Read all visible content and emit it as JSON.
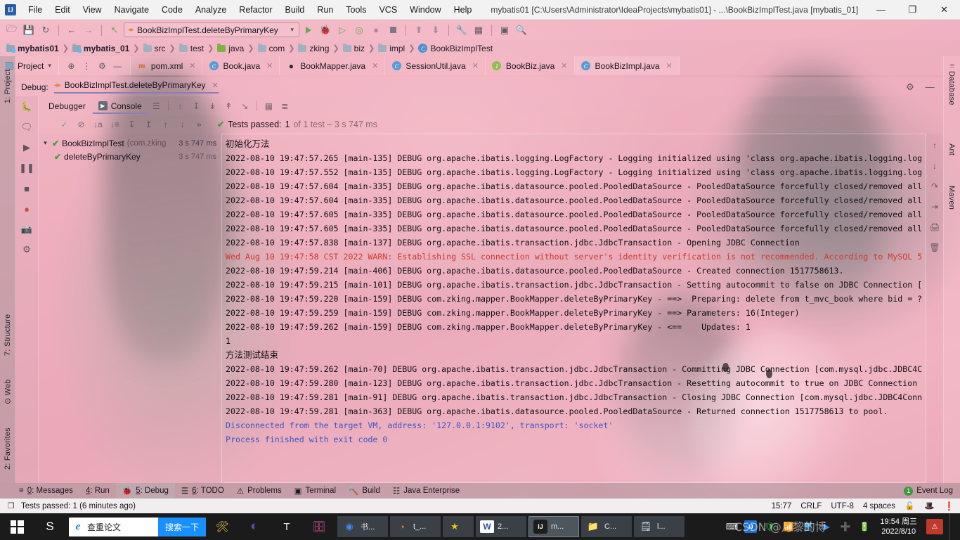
{
  "titlebar": {
    "logo": "IJ",
    "title": "mybatis01 [C:\\Users\\Administrator\\IdeaProjects\\mybatis01] - ...\\BookBizImplTest.java [mybatis_01]",
    "menu": [
      "File",
      "Edit",
      "View",
      "Navigate",
      "Code",
      "Analyze",
      "Refactor",
      "Build",
      "Run",
      "Tools",
      "VCS",
      "Window",
      "Help"
    ],
    "minimize": "—",
    "maximize": "❐",
    "close": "✕"
  },
  "toolbar": {
    "open_icon": "🗁",
    "save_icon": "💾",
    "sync_icon": "↻",
    "back_icon": "←",
    "forward_icon": "→",
    "build_icon": "↖",
    "run_config": "BookBizImplTest.deleteByPrimaryKey",
    "run_icon": "▶",
    "debug_icon": "🐞",
    "coverage_icon": "▶",
    "profile_icon": "▶",
    "attach_icon": "▶",
    "stop_icon": "■",
    "deploy_icon": "⬆",
    "update_icon": "⬇",
    "settings_icon": "🔧",
    "structure_icon": "⬛",
    "layout_icon": "◱",
    "search_icon": "🔍"
  },
  "breadcrumb": [
    {
      "label": "mybatis01",
      "type": "module",
      "bold": true
    },
    {
      "label": "mybatis_01",
      "type": "module",
      "bold": true
    },
    {
      "label": "src",
      "type": "folder",
      "bold": false
    },
    {
      "label": "test",
      "type": "folder",
      "bold": false
    },
    {
      "label": "java",
      "type": "source-folder",
      "bold": false
    },
    {
      "label": "com",
      "type": "folder",
      "bold": false
    },
    {
      "label": "zking",
      "type": "folder",
      "bold": false
    },
    {
      "label": "biz",
      "type": "folder",
      "bold": false
    },
    {
      "label": "impl",
      "type": "folder",
      "bold": false
    },
    {
      "label": "BookBizImplTest",
      "type": "class",
      "bold": false
    }
  ],
  "project_panel": {
    "label": "Project",
    "caret": "▾",
    "locate_icon": "⊕",
    "collapse_icon": "➕",
    "settings_icon": "⚙",
    "hide_icon": "—"
  },
  "editor_tabs": [
    {
      "label": "pom.xml",
      "icon": "m",
      "type": "maven",
      "active": false
    },
    {
      "label": "Book.java",
      "icon": "C",
      "type": "class",
      "active": false
    },
    {
      "label": "BookMapper.java",
      "icon": "◕",
      "type": "mapper",
      "active": false
    },
    {
      "label": "SessionUtil.java",
      "icon": "C",
      "type": "class",
      "active": false
    },
    {
      "label": "BookBiz.java",
      "icon": "I",
      "type": "interface",
      "active": false
    },
    {
      "label": "BookBizImpl.java",
      "icon": "C",
      "type": "class",
      "active": true
    }
  ],
  "left_tool_tabs": [
    "1: Project",
    "7: Structure",
    "⊙ Web",
    "2: Favorites"
  ],
  "right_tool_tabs": [
    "Database",
    "Ant",
    "Maven"
  ],
  "debug_window": {
    "label": "Debug:",
    "config_name": "BookBizImplTest.deleteByPrimaryKey",
    "close": "✕",
    "settings_icon": "⚙",
    "hide_icon": "—",
    "tabs": [
      {
        "label": "Debugger",
        "active": false
      },
      {
        "label": "Console",
        "active": true
      }
    ],
    "rail_icons": [
      "🐞",
      "💬",
      "⏸",
      "⏹",
      "🔴",
      "📷",
      "⚙"
    ],
    "toolbar_icons": [
      "✓",
      "⊘",
      "↓az",
      "↓≡",
      "↧",
      "↥",
      "↑",
      "↓",
      "»"
    ]
  },
  "test_status": {
    "check": "✔",
    "label": "Tests passed:",
    "count": "1",
    "detail": "of 1 test – 3 s 747 ms"
  },
  "test_tree": [
    {
      "name": "BookBizImplTest",
      "package": "(com.zking",
      "time": "3 s 747 ms",
      "level": 0,
      "expanded": true,
      "status": "passed"
    },
    {
      "name": "deleteByPrimaryKey",
      "package": "",
      "time": "3 s 747 ms",
      "level": 1,
      "expanded": false,
      "status": "passed"
    }
  ],
  "console_lines": [
    {
      "text": "初始化万法",
      "style": "cn"
    },
    {
      "text": "2022-08-10 19:47:57.265 [main-135] DEBUG org.apache.ibatis.logging.LogFactory - Logging initialized using 'class org.apache.ibatis.logging.log",
      "style": "normal"
    },
    {
      "text": "2022-08-10 19:47:57.552 [main-135] DEBUG org.apache.ibatis.logging.LogFactory - Logging initialized using 'class org.apache.ibatis.logging.log",
      "style": "normal"
    },
    {
      "text": "2022-08-10 19:47:57.604 [main-335] DEBUG org.apache.ibatis.datasource.pooled.PooledDataSource - PooledDataSource forcefully closed/removed all",
      "style": "normal"
    },
    {
      "text": "2022-08-10 19:47:57.604 [main-335] DEBUG org.apache.ibatis.datasource.pooled.PooledDataSource - PooledDataSource forcefully closed/removed all",
      "style": "normal"
    },
    {
      "text": "2022-08-10 19:47:57.605 [main-335] DEBUG org.apache.ibatis.datasource.pooled.PooledDataSource - PooledDataSource forcefully closed/removed all",
      "style": "normal"
    },
    {
      "text": "2022-08-10 19:47:57.605 [main-335] DEBUG org.apache.ibatis.datasource.pooled.PooledDataSource - PooledDataSource forcefully closed/removed all",
      "style": "normal"
    },
    {
      "text": "2022-08-10 19:47:57.838 [main-137] DEBUG org.apache.ibatis.transaction.jdbc.JdbcTransaction - Opening JDBC Connection",
      "style": "normal"
    },
    {
      "text": "Wed Aug 10 19:47:58 CST 2022 WARN: Establishing SSL connection without server's identity verification is not recommended. According to MySQL 5",
      "style": "warn"
    },
    {
      "text": "2022-08-10 19:47:59.214 [main-406] DEBUG org.apache.ibatis.datasource.pooled.PooledDataSource - Created connection 1517758613.",
      "style": "normal"
    },
    {
      "text": "2022-08-10 19:47:59.215 [main-101] DEBUG org.apache.ibatis.transaction.jdbc.JdbcTransaction - Setting autocommit to false on JDBC Connection [",
      "style": "normal"
    },
    {
      "text": "2022-08-10 19:47:59.220 [main-159] DEBUG com.zking.mapper.BookMapper.deleteByPrimaryKey - ==>  Preparing: delete from t_mvc_book where bid = ?",
      "style": "normal"
    },
    {
      "text": "2022-08-10 19:47:59.259 [main-159] DEBUG com.zking.mapper.BookMapper.deleteByPrimaryKey - ==> Parameters: 16(Integer)",
      "style": "normal"
    },
    {
      "text": "2022-08-10 19:47:59.262 [main-159] DEBUG com.zking.mapper.BookMapper.deleteByPrimaryKey - <==    Updates: 1",
      "style": "normal"
    },
    {
      "text": "1",
      "style": "normal"
    },
    {
      "text": "方法测试结束",
      "style": "cn"
    },
    {
      "text": "2022-08-10 19:47:59.262 [main-70] DEBUG org.apache.ibatis.transaction.jdbc.JdbcTransaction - Committing JDBC Connection [com.mysql.jdbc.JDBC4C",
      "style": "normal"
    },
    {
      "text": "2022-08-10 19:47:59.280 [main-123] DEBUG org.apache.ibatis.transaction.jdbc.JdbcTransaction - Resetting autocommit to true on JDBC Connection",
      "style": "normal"
    },
    {
      "text": "2022-08-10 19:47:59.281 [main-91] DEBUG org.apache.ibatis.transaction.jdbc.JdbcTransaction - Closing JDBC Connection [com.mysql.jdbc.JDBC4Conn",
      "style": "normal"
    },
    {
      "text": "2022-08-10 19:47:59.281 [main-363] DEBUG org.apache.ibatis.datasource.pooled.PooledDataSource - Returned connection 1517758613 to pool.",
      "style": "normal"
    },
    {
      "text": "Disconnected from the target VM, address: '127.0.0.1:9102', transport: 'socket'",
      "style": "blue"
    },
    {
      "text": "",
      "style": "normal"
    },
    {
      "text": "Process finished with exit code 0",
      "style": "blue"
    }
  ],
  "console_rail_icons": [
    "↑",
    "↓",
    "↲",
    "⇥",
    "🖨",
    "🗑"
  ],
  "bottom_tool_windows": [
    {
      "num": "0",
      "label": ": Messages",
      "icon": "≡",
      "active": false
    },
    {
      "num": "4",
      "label": ": Run",
      "icon": "▶",
      "active": false
    },
    {
      "num": "5",
      "label": ": Debug",
      "icon": "🐞",
      "active": true
    },
    {
      "num": "6",
      "label": ": TODO",
      "icon": "☰",
      "active": false
    },
    {
      "num": "",
      "label": "Problems",
      "icon": "⚠",
      "active": false
    },
    {
      "num": "",
      "label": "Terminal",
      "icon": "▣",
      "active": false
    },
    {
      "num": "",
      "label": "Build",
      "icon": "🔨",
      "active": false
    },
    {
      "num": "",
      "label": "Java Enterprise",
      "icon": "☷",
      "active": false
    }
  ],
  "event_log": {
    "badge": "1",
    "label": "Event Log"
  },
  "statusbar": {
    "message_icon": "❐",
    "message": "Tests passed: 1 (6 minutes ago)",
    "caret_pos": "15:77",
    "line_sep": "CRLF",
    "encoding": "UTF-8",
    "indent": "4 spaces",
    "lock_icon": "🔓",
    "inspect_icon": "🎩",
    "error_icon": "❗"
  },
  "taskbar": {
    "start": "⊞",
    "sogou_icon": "S",
    "search": {
      "engine_icon": "e",
      "query": "查重论文",
      "button": "搜索一下"
    },
    "pinned": [
      {
        "name": "tools-icon",
        "glyph": "🛠"
      },
      {
        "name": "eclipse-icon",
        "glyph": "◐"
      },
      {
        "name": "typora-icon",
        "glyph": "T"
      },
      {
        "name": "navicat-icon",
        "glyph": "🗄"
      }
    ],
    "running": [
      {
        "name": "chrome-window",
        "glyph": "◉",
        "label": "书..."
      },
      {
        "name": "navicat-window",
        "glyph": "◔",
        "label": "t_..."
      },
      {
        "name": "star-window",
        "glyph": "★",
        "label": ""
      },
      {
        "name": "word-window",
        "glyph": "W",
        "label": "2..."
      },
      {
        "name": "idea-window",
        "glyph": "IJ",
        "label": "m...",
        "selected": true
      },
      {
        "name": "explorer-window",
        "glyph": "📁",
        "label": "C..."
      },
      {
        "name": "notepad-window",
        "glyph": "🗒",
        "label": "l..."
      }
    ],
    "tray": [
      "⌨",
      "IJ",
      "🛡",
      "📶",
      "🖥",
      "▶",
      "➕",
      "🔋"
    ],
    "clock_time": "19:54 周三",
    "clock_date": "2022/8/10",
    "watermark": "CSDN @月黎的博"
  }
}
